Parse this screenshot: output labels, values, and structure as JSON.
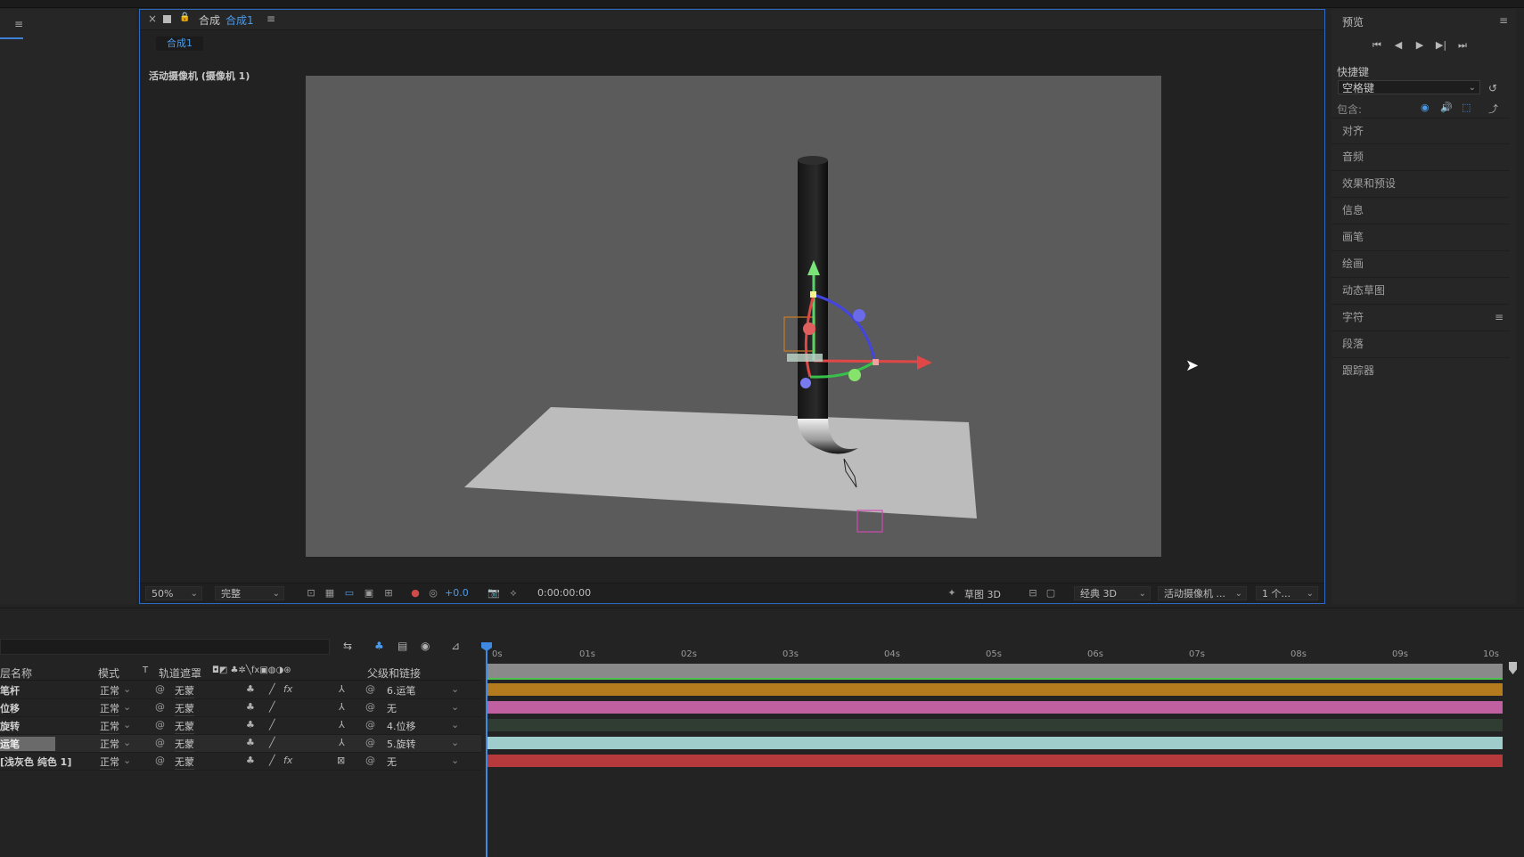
{
  "comp_panel": {
    "close": "×",
    "label": "合成",
    "name": "合成1",
    "menu": "≡",
    "subtab": "合成1",
    "camera_label": "活动摄像机 (摄像机 1)"
  },
  "left_panel": {
    "menu": "≡"
  },
  "viewer_footer": {
    "zoom": "50%",
    "resolution": "完整",
    "exposure": "+0.0",
    "timecode": "0:00:00:00",
    "draft3d": "草图 3D",
    "renderer": "经典 3D",
    "camera": "活动摄像机 ...",
    "views": "1 个..."
  },
  "right_panel": {
    "preview_title": "预览",
    "menu": "≡",
    "controls": [
      "⏮",
      "◀",
      "▶",
      "▶|",
      "⏭"
    ],
    "shortcut_label": "快捷键",
    "shortcut_value": "空格键",
    "include_label": "包含:",
    "sections": [
      "对齐",
      "音频",
      "效果和预设",
      "信息",
      "画笔",
      "绘画",
      "动态草图",
      "字符",
      "段落",
      "跟踪器"
    ]
  },
  "timeline": {
    "columns": {
      "layer_name": "层名称",
      "mode": "模式",
      "t": "T",
      "matte": "轨道遮罩",
      "parent": "父级和链接"
    },
    "layers": [
      {
        "name": "笔杆",
        "mode": "正常",
        "matte": "无蒙",
        "parent": "6.运笔",
        "has_fx": true
      },
      {
        "name": "位移",
        "mode": "正常",
        "matte": "无蒙",
        "parent": "无",
        "has_fx": false
      },
      {
        "name": "旋转",
        "mode": "正常",
        "matte": "无蒙",
        "parent": "4.位移",
        "has_fx": false
      },
      {
        "name": "运笔",
        "mode": "正常",
        "matte": "无蒙",
        "parent": "5.旋转",
        "has_fx": false
      },
      {
        "name": "[浅灰色 纯色 1]",
        "mode": "正常",
        "matte": "无蒙",
        "parent": "无",
        "has_fx": true
      }
    ],
    "ruler": [
      "0s",
      "01s",
      "02s",
      "03s",
      "04s",
      "05s",
      "06s",
      "07s",
      "08s",
      "09s",
      "10s"
    ],
    "colors": {
      "layer_bars": [
        "#b37a1e",
        "#c060a0",
        "#2f3d32",
        "#9ecdcb",
        "#b63a3c"
      ],
      "top_bar": "#8a8a8a",
      "accent": "#3f8ae0"
    }
  },
  "colors": {
    "accent": "#2d6bc2",
    "background": "#232323",
    "viewport": "#5b5b5b"
  }
}
